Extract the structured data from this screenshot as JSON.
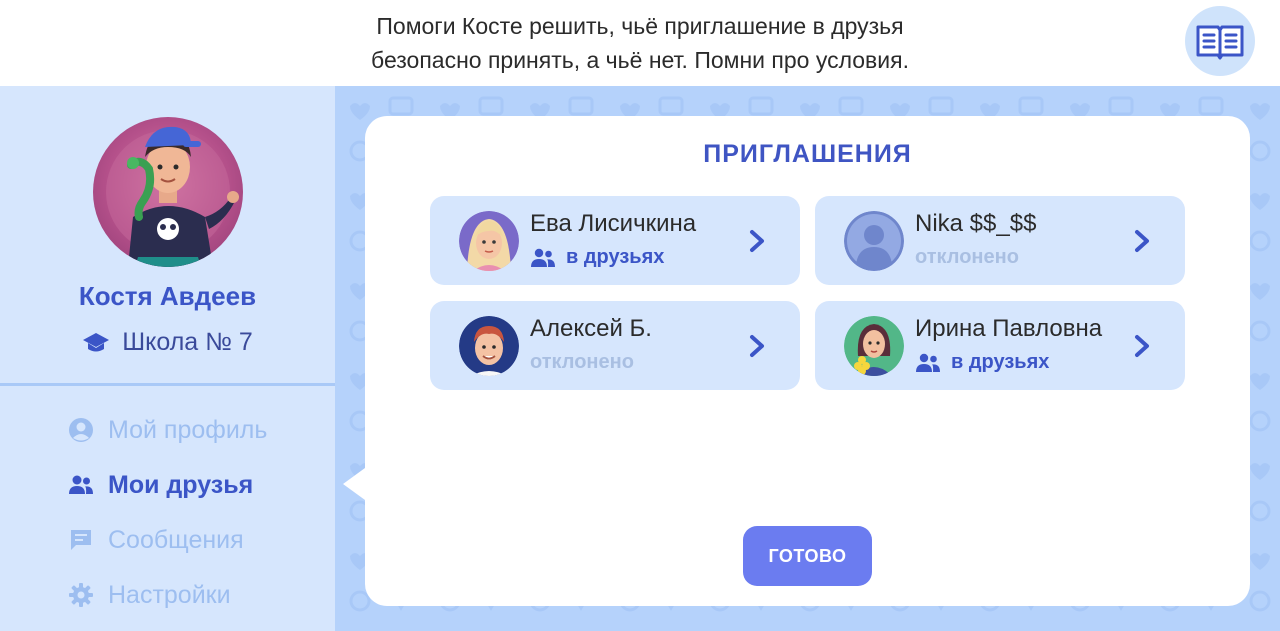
{
  "task": {
    "line1": "Помоги Косте решить, чьё приглашение в друзья",
    "line2": "безопасно принять, а чьё нет. Помни про условия."
  },
  "header": {
    "book_icon": "open-book-icon"
  },
  "profile": {
    "name": "Костя Авдеев",
    "school": "Школа № 7",
    "school_icon": "graduation-cap-icon"
  },
  "menu": [
    {
      "label": "Мой профиль",
      "icon": "user-circle-icon",
      "active": false
    },
    {
      "label": "Мои друзья",
      "icon": "friends-icon",
      "active": true
    },
    {
      "label": "Сообщения",
      "icon": "message-icon",
      "active": false
    },
    {
      "label": "Настройки",
      "icon": "gear-icon",
      "active": false
    }
  ],
  "invitations": {
    "title": "ПРИГЛАШЕНИЯ",
    "items": [
      {
        "name": "Ева Лисичкина",
        "status": "в друзьях",
        "status_type": "friends"
      },
      {
        "name": "Nika $$_$$",
        "status": "отклонено",
        "status_type": "declined"
      },
      {
        "name": "Алексей Б.",
        "status": "отклонено",
        "status_type": "declined"
      },
      {
        "name": "Ирина Павловна",
        "status": "в друзьях",
        "status_type": "friends"
      }
    ]
  },
  "done_button": "ГОТОВО",
  "colors": {
    "accent": "#3b55c7",
    "sidebar_bg": "#d6e6fd",
    "main_bg": "#b5d2fb",
    "button": "#6b7cf0",
    "declined": "#a9bfe2"
  }
}
